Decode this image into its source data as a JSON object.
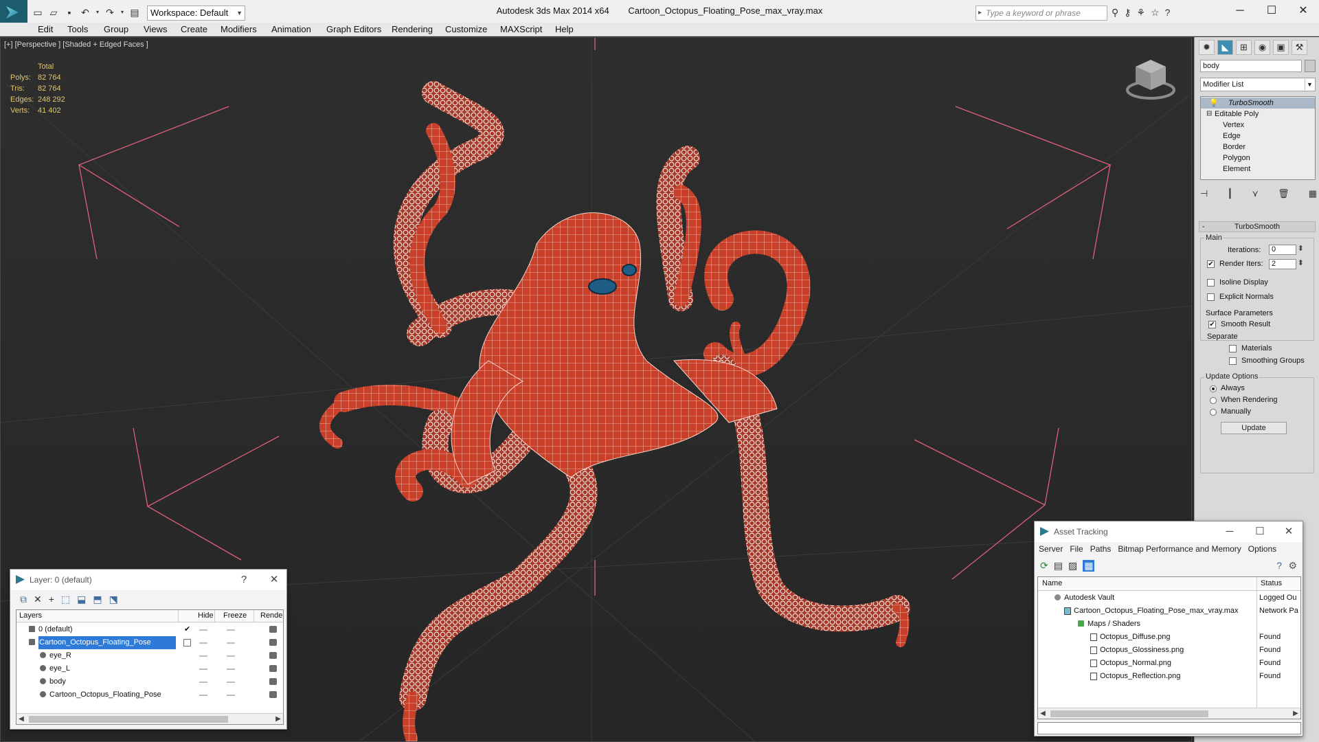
{
  "app": {
    "title_app": "Autodesk 3ds Max  2014 x64",
    "title_file": "Cartoon_Octopus_Floating_Pose_max_vray.max",
    "workspace": "Workspace: Default",
    "search_placeholder": "Type a keyword or phrase"
  },
  "menu": [
    "Edit",
    "Tools",
    "Group",
    "Views",
    "Create",
    "Modifiers",
    "Animation",
    "Graph Editors",
    "Rendering",
    "Customize",
    "MAXScript",
    "Help"
  ],
  "viewport": {
    "label": "[+] [Perspective ] [Shaded + Edged Faces ]",
    "stats": {
      "header": "Total",
      "rows": [
        {
          "key": "Polys:",
          "value": "82 764"
        },
        {
          "key": "Tris:",
          "value": "82 764"
        },
        {
          "key": "Edges:",
          "value": "248 292"
        },
        {
          "key": "Verts:",
          "value": "41 402"
        }
      ]
    }
  },
  "command_panel": {
    "object_name": "body",
    "modifier_list": "Modifier List",
    "stack": [
      "TurboSmooth",
      "Editable Poly",
      "Vertex",
      "Edge",
      "Border",
      "Polygon",
      "Element"
    ],
    "rollout_title": "TurboSmooth",
    "main_group": "Main",
    "iterations_label": "Iterations:",
    "iterations_value": "0",
    "render_iters_label": "Render Iters:",
    "render_iters_value": "2",
    "isoline_label": "Isoline Display",
    "explicit_label": "Explicit Normals",
    "surface_group": "Surface Parameters",
    "smooth_result_label": "Smooth Result",
    "separate_label": "Separate",
    "materials_label": "Materials",
    "smoothing_groups_label": "Smoothing Groups",
    "update_group": "Update Options",
    "always_label": "Always",
    "when_rendering_label": "When Rendering",
    "manually_label": "Manually",
    "update_button": "Update"
  },
  "layer_window": {
    "title": "Layer: 0 (default)",
    "help": "?",
    "close": "✕",
    "columns": [
      "Layers",
      "Hide",
      "Freeze",
      "Render"
    ],
    "rows": [
      {
        "name": "0 (default)",
        "indent": 1
      },
      {
        "name": "Cartoon_Octopus_Floating_Pose",
        "indent": 1,
        "selected": true
      },
      {
        "name": "eye_R",
        "indent": 2
      },
      {
        "name": "eye_L",
        "indent": 2
      },
      {
        "name": "body",
        "indent": 2
      },
      {
        "name": "Cartoon_Octopus_Floating_Pose",
        "indent": 2
      }
    ]
  },
  "asset_window": {
    "title": "Asset Tracking",
    "menu": [
      "Server",
      "File",
      "Paths",
      "Bitmap Performance and Memory",
      "Options"
    ],
    "columns": [
      "Name",
      "Status"
    ],
    "rows": [
      {
        "name": "Autodesk Vault",
        "status": "Logged Ou"
      },
      {
        "name": "Cartoon_Octopus_Floating_Pose_max_vray.max",
        "status": "Network Pa"
      },
      {
        "name": "Maps / Shaders",
        "status": ""
      },
      {
        "name": "Octopus_Diffuse.png",
        "status": "Found"
      },
      {
        "name": "Octopus_Glossiness.png",
        "status": "Found"
      },
      {
        "name": "Octopus_Normal.png",
        "status": "Found"
      },
      {
        "name": "Octopus_Reflection.png",
        "status": "Found"
      }
    ]
  },
  "colors": {
    "viewport_bg": "#2b2b2b",
    "octopus_body": "#c8402a",
    "suckers": "#f4e6dc",
    "stats_text": "#e2c86a",
    "selection": "#2d7ad8",
    "bbox_lines": "#e0607a"
  }
}
